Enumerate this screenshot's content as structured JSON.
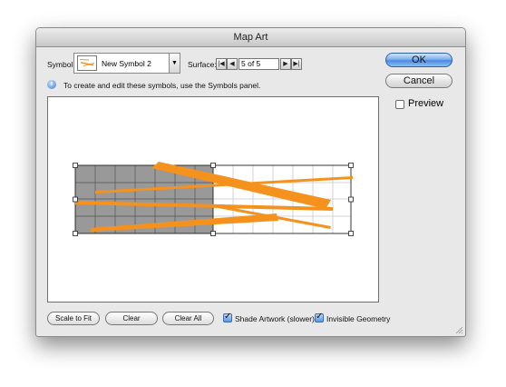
{
  "dialog": {
    "title": "Map Art"
  },
  "symbol": {
    "label": "Symbol:",
    "selected": "New Symbol 2"
  },
  "surface": {
    "label": "Surface:",
    "value": "5 of 5",
    "current": 5,
    "total": 5
  },
  "info": {
    "text": "To create and edit these symbols, use the Symbols panel."
  },
  "buttons": {
    "ok": "OK",
    "cancel": "Cancel",
    "scale_to_fit": "Scale to Fit",
    "clear": "Clear",
    "clear_all": "Clear All"
  },
  "options": {
    "preview_label": "Preview",
    "preview_checked": false,
    "shade_artwork_label": "Shade Artwork (slower)",
    "shade_artwork_checked": true,
    "invisible_geometry_label": "Invisible Geometry",
    "invisible_geometry_checked": true
  },
  "colors": {
    "artwork": "#f5921e",
    "default_button": "#5b96e4",
    "surface_shade": "#999999"
  },
  "icons": {
    "info": "info-icon",
    "first": "first-page-icon",
    "prev": "previous-icon",
    "next": "next-icon",
    "last": "last-page-icon",
    "dropdown": "chevron-down-icon"
  }
}
